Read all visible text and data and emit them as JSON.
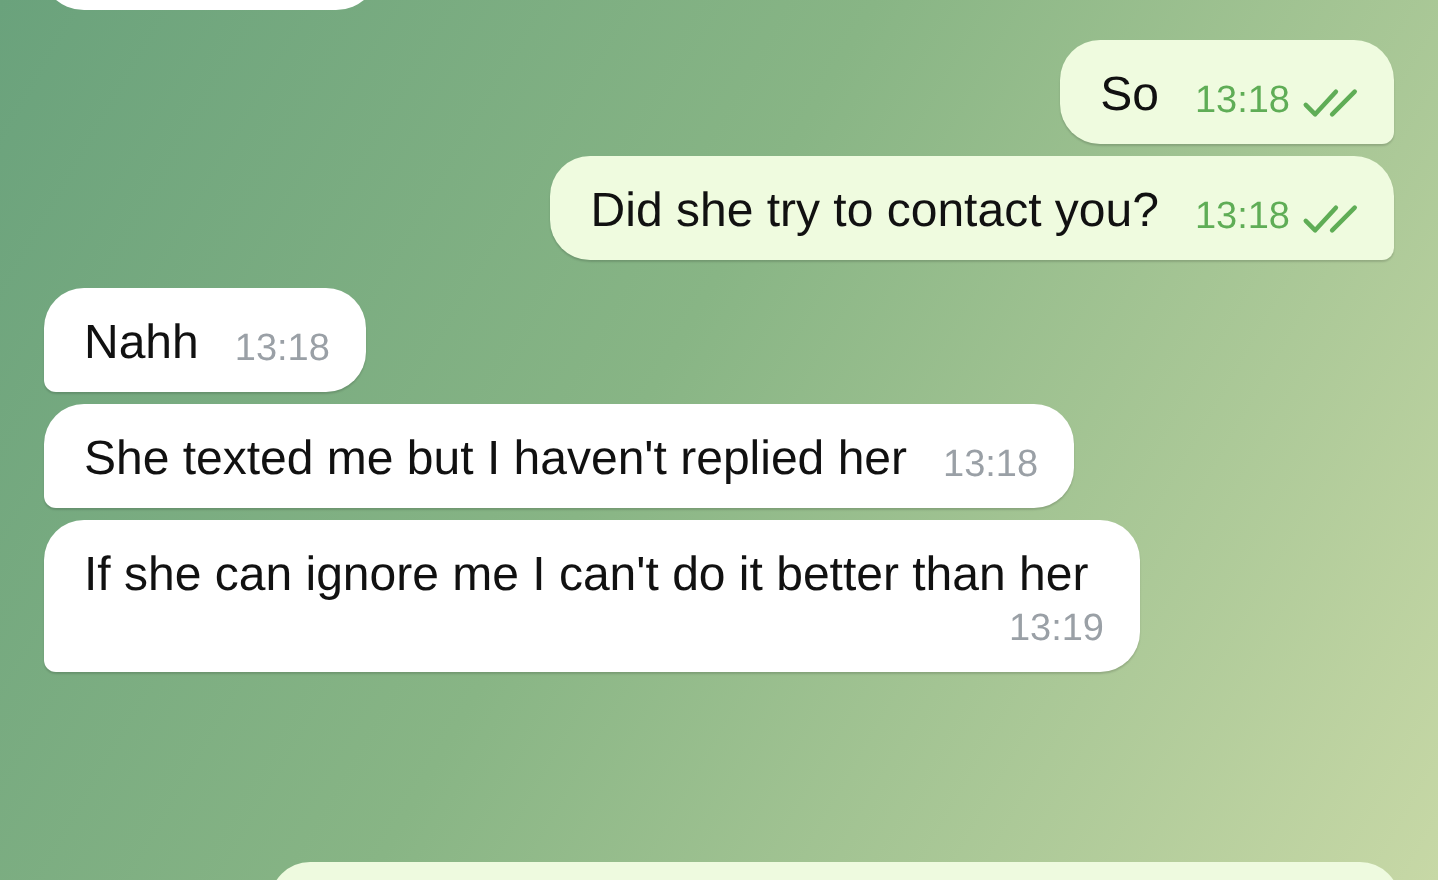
{
  "messages": [
    {
      "kind": "outgoing",
      "text": "So",
      "time": "13:18",
      "read": true
    },
    {
      "kind": "outgoing",
      "text": "Did she try to contact you?",
      "time": "13:18",
      "read": true
    },
    {
      "kind": "incoming",
      "text": "Nahh",
      "time": "13:18"
    },
    {
      "kind": "incoming",
      "text": "She texted me but I haven't replied her",
      "time": "13:18"
    },
    {
      "kind": "incoming",
      "text": "If she can ignore me I can't do it better than her",
      "time": "13:19"
    }
  ]
}
